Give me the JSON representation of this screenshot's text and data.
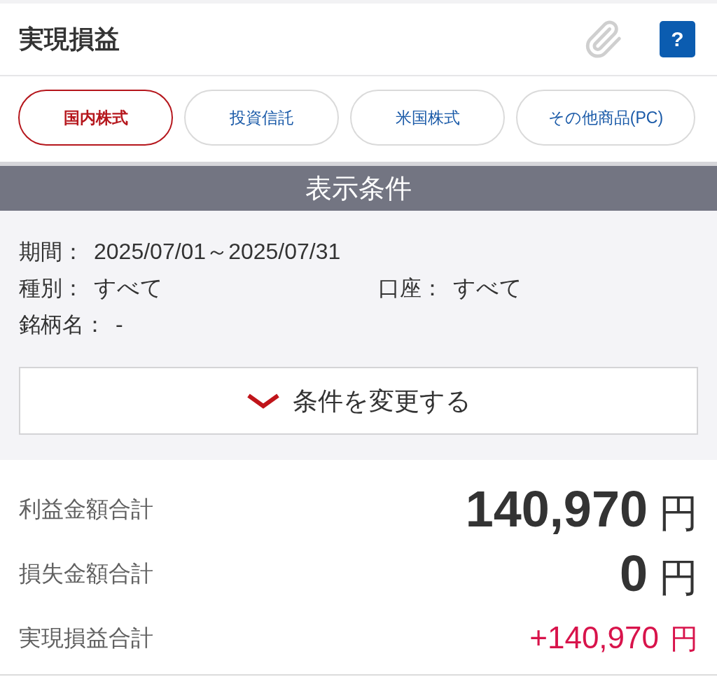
{
  "header": {
    "title": "実現損益",
    "help_button": {
      "label": "?"
    }
  },
  "tabs": [
    {
      "label": "国内株式",
      "selected": true
    },
    {
      "label": "投資信託",
      "selected": false
    },
    {
      "label": "米国株式",
      "selected": false
    },
    {
      "label": "その他商品(PC)",
      "selected": false
    }
  ],
  "conditions": {
    "title": "表示条件",
    "rows": [
      {
        "items": [
          {
            "label": "期間：",
            "value": "2025/07/01～2025/07/31"
          }
        ]
      },
      {
        "items": [
          {
            "label": "種別：",
            "value": "すべて"
          },
          {
            "label": "口座：",
            "value": "すべて"
          }
        ]
      },
      {
        "items": [
          {
            "label": "銘柄名：",
            "value": "-"
          }
        ]
      }
    ],
    "change_button": {
      "label": "条件を変更する"
    }
  },
  "summary": [
    {
      "label": "利益金額合計",
      "value": "140,970",
      "unit": "円",
      "kind": "total"
    },
    {
      "label": "損失金額合計",
      "value": "0",
      "unit": "円",
      "kind": "total"
    },
    {
      "label": "実現損益合計",
      "value": "+140,970",
      "unit": "円",
      "kind": "profit"
    }
  ]
}
